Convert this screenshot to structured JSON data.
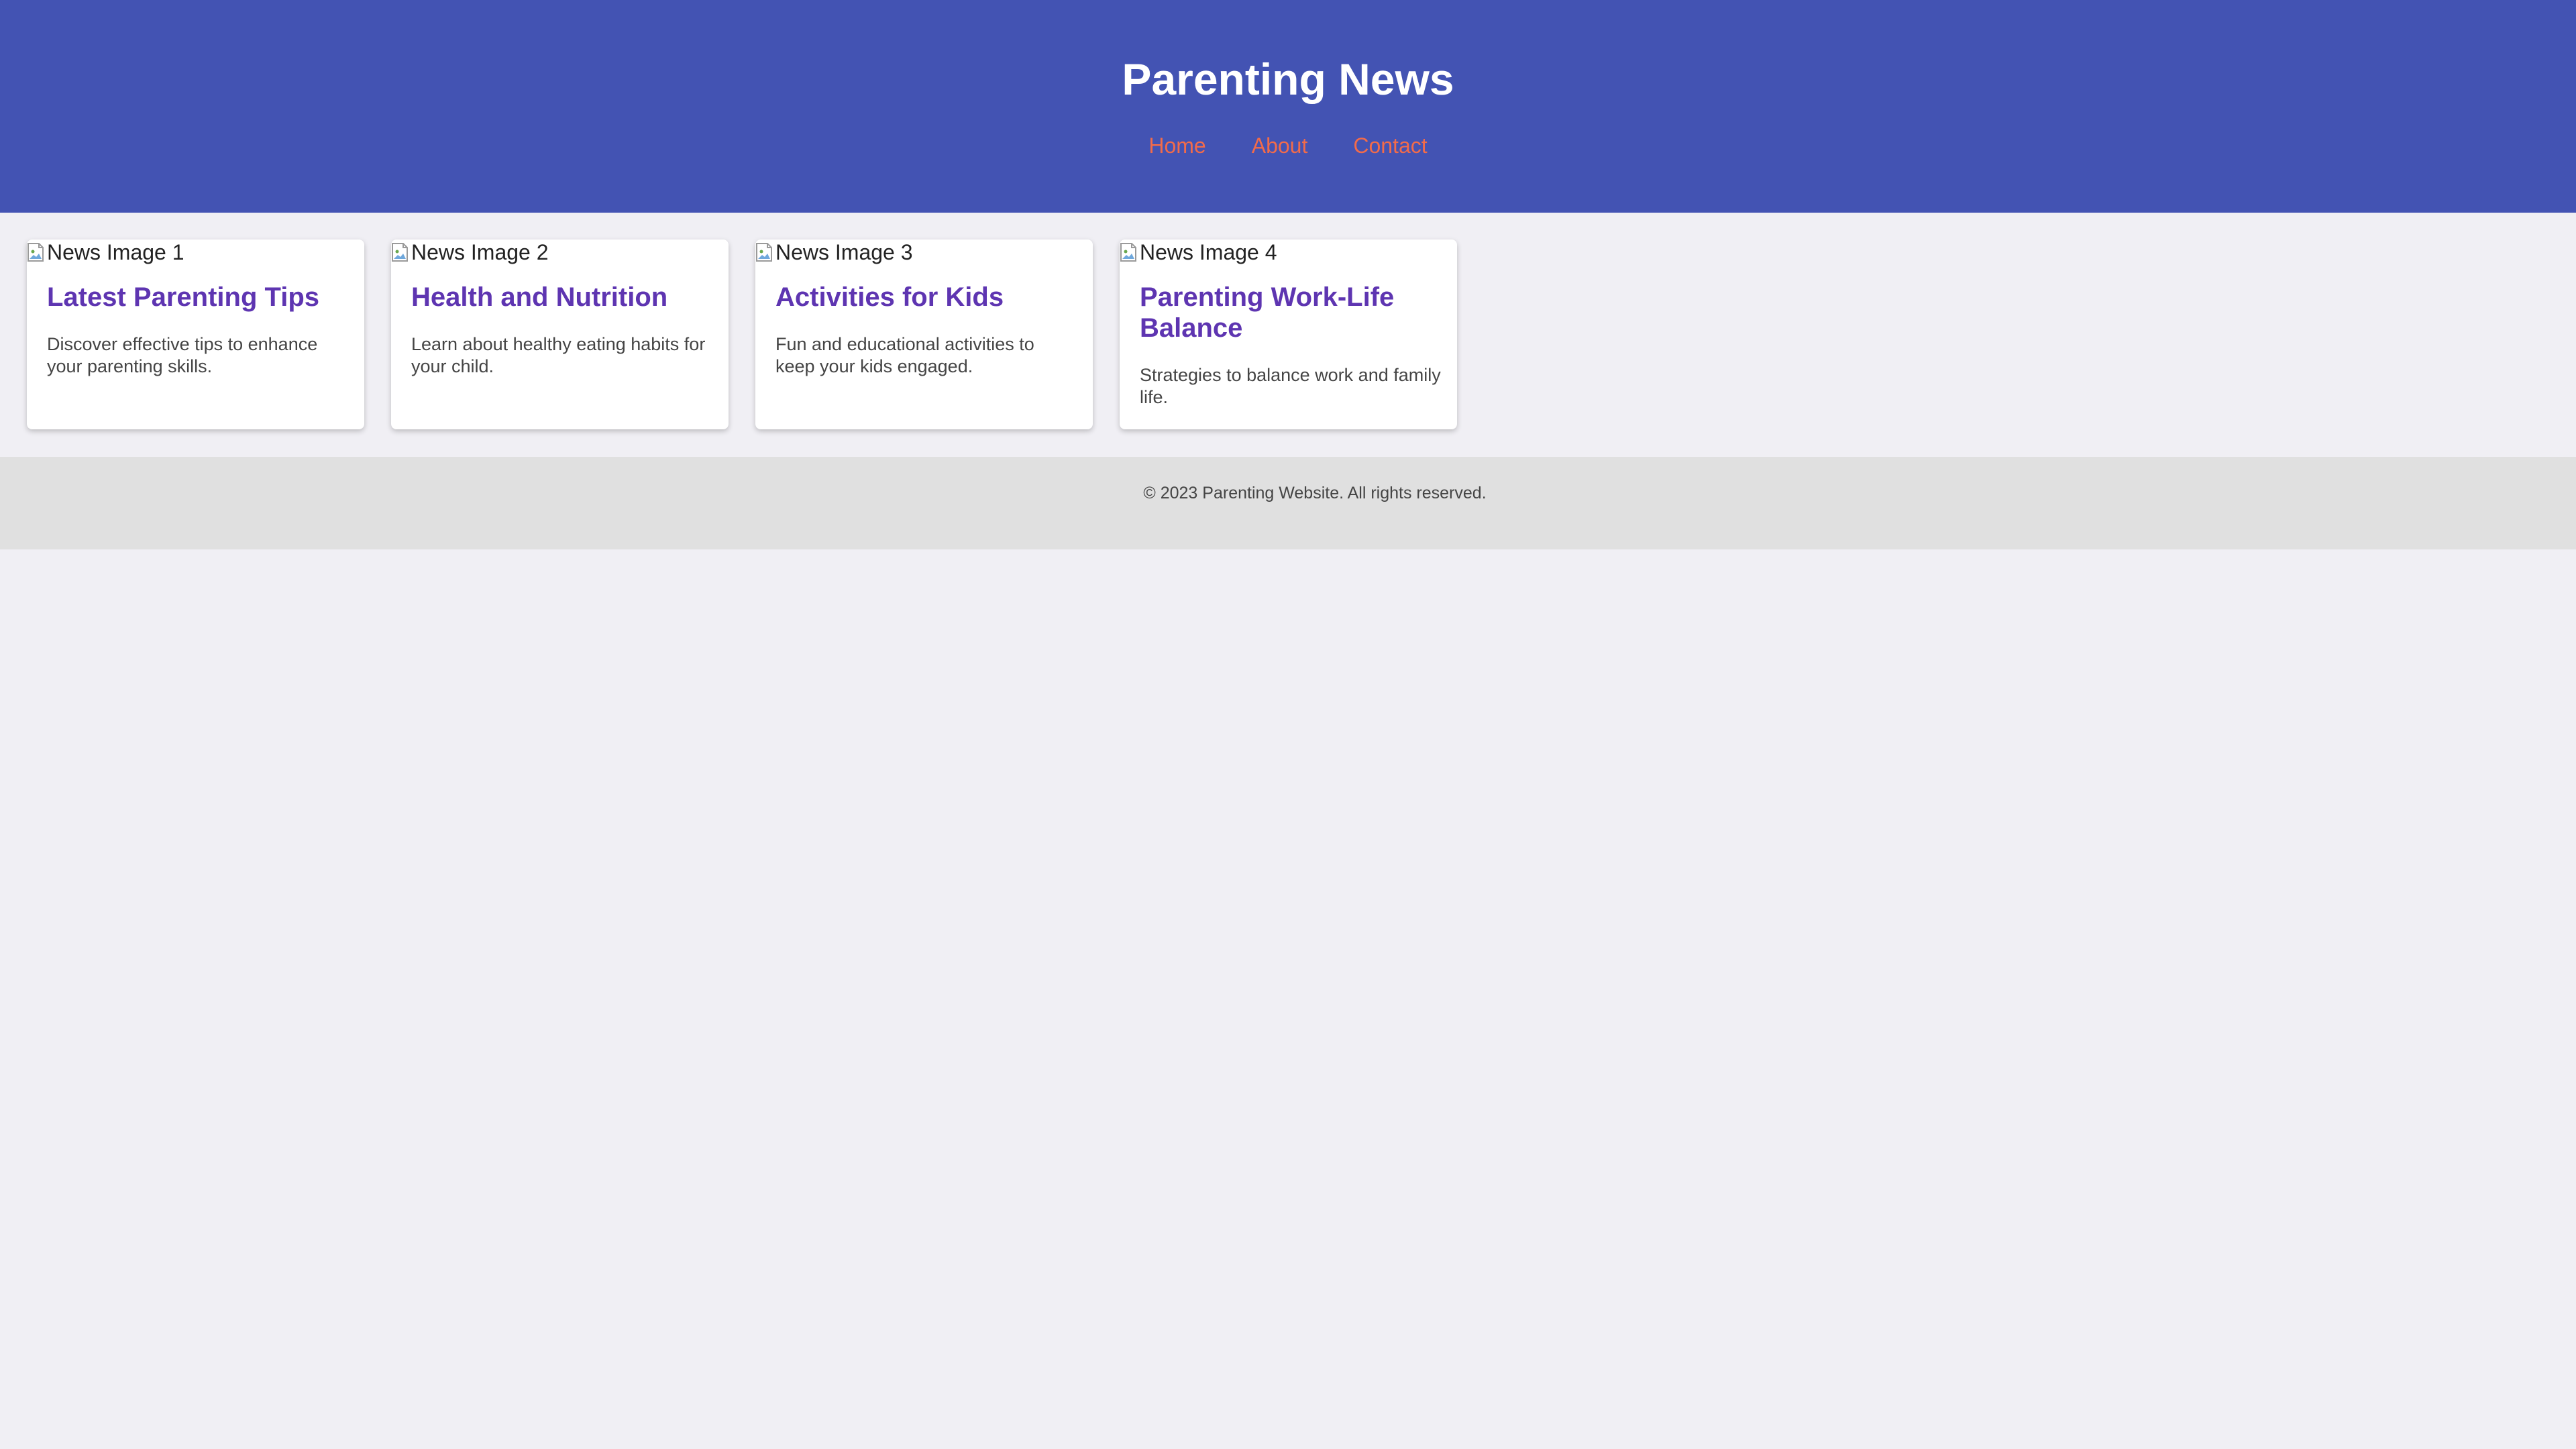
{
  "header": {
    "title": "Parenting News",
    "nav": [
      {
        "label": "Home"
      },
      {
        "label": "About"
      },
      {
        "label": "Contact"
      }
    ]
  },
  "cards": [
    {
      "image_alt": "News Image 1",
      "title": "Latest Parenting Tips",
      "description": "Discover effective tips to enhance your parenting skills."
    },
    {
      "image_alt": "News Image 2",
      "title": "Health and Nutrition",
      "description": "Learn about healthy eating habits for your child."
    },
    {
      "image_alt": "News Image 3",
      "title": "Activities for Kids",
      "description": "Fun and educational activities to keep your kids engaged."
    },
    {
      "image_alt": "News Image 4",
      "title": "Parenting Work-Life Balance",
      "description": "Strategies to balance work and family life."
    }
  ],
  "footer": {
    "text": "© 2023 Parenting Website. All rights reserved."
  },
  "colors": {
    "header_bg": "#4353b3",
    "nav_link": "#f26b4a",
    "card_title": "#5e35b1",
    "page_bg": "#f0eff4",
    "footer_bg": "#e0e0e0"
  }
}
